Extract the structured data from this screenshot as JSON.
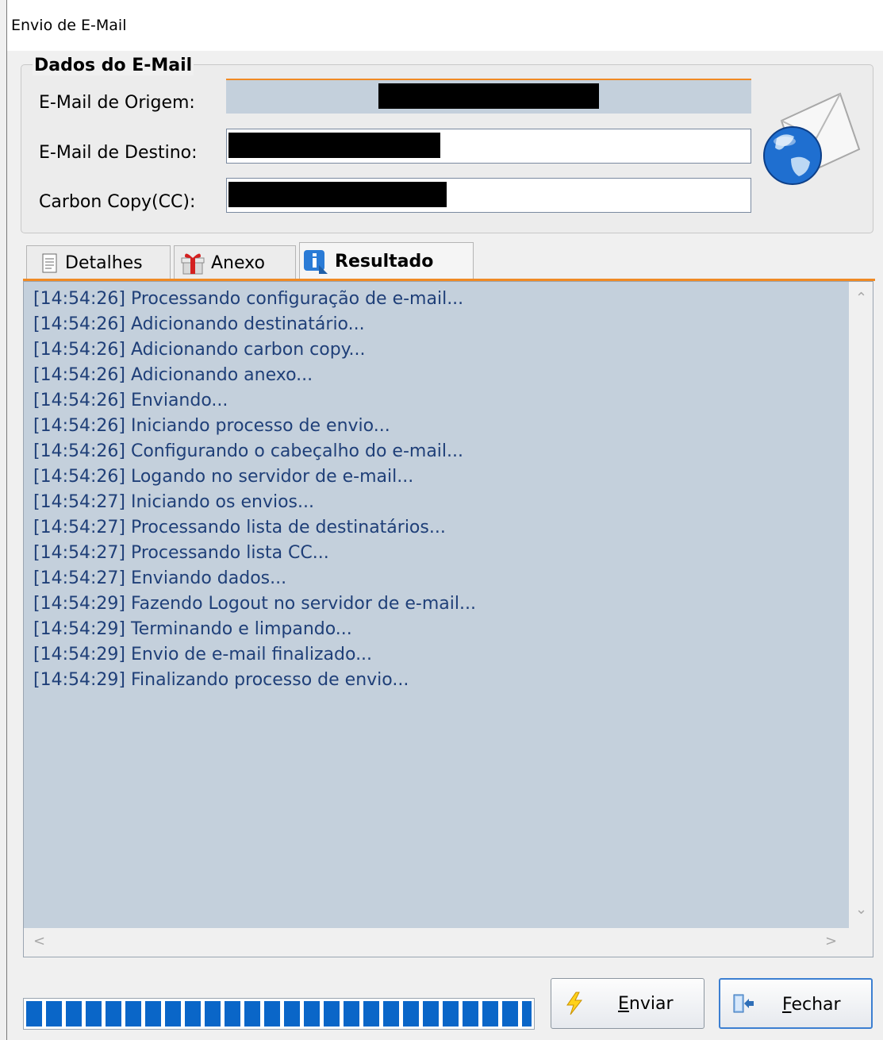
{
  "window": {
    "title": "Envio de E-Mail"
  },
  "group": {
    "legend": "Dados do E-Mail",
    "fields": [
      {
        "label": "E-Mail de Origem:",
        "value": ""
      },
      {
        "label": "E-Mail de Destino:",
        "value": ""
      },
      {
        "label": "Carbon Copy(CC):",
        "value": ""
      }
    ],
    "icon": "email-globe-icon"
  },
  "tabs": [
    {
      "label": "Detalhes",
      "icon": "document-icon",
      "active": false
    },
    {
      "label": "Anexo",
      "icon": "gift-icon",
      "active": false
    },
    {
      "label": "Resultado",
      "icon": "info-icon",
      "active": true
    }
  ],
  "log": {
    "lines": [
      "[14:54:26] Processando configuração de e-mail...",
      "[14:54:26] Adicionando destinatário...",
      "[14:54:26] Adicionando carbon copy...",
      "[14:54:26] Adicionando anexo...",
      "[14:54:26] Enviando...",
      "[14:54:26] Iniciando processo de envio...",
      "[14:54:26] Configurando o cabeçalho do e-mail...",
      "[14:54:26] Logando no servidor de e-mail...",
      "[14:54:27] Iniciando os envios...",
      "[14:54:27] Processando lista de destinatários...",
      "[14:54:27] Processando lista CC...",
      "[14:54:27] Enviando dados...",
      "[14:54:29] Fazendo Logout no servidor de e-mail...",
      "[14:54:29] Terminando e limpando...",
      "[14:54:29] Envio de e-mail finalizado...",
      "[14:54:29] Finalizando processo de envio..."
    ]
  },
  "progress": {
    "fraction": 1.0
  },
  "buttons": {
    "send": {
      "accel": "E",
      "rest": "nviar",
      "icon": "lightning-icon"
    },
    "close": {
      "accel": "F",
      "rest": "echar",
      "icon": "exit-door-icon"
    }
  },
  "colors": {
    "accent": "#f08a24",
    "log_text": "#1f3f78",
    "log_bg": "#c4d0dc",
    "progress": "#0a66c8"
  }
}
